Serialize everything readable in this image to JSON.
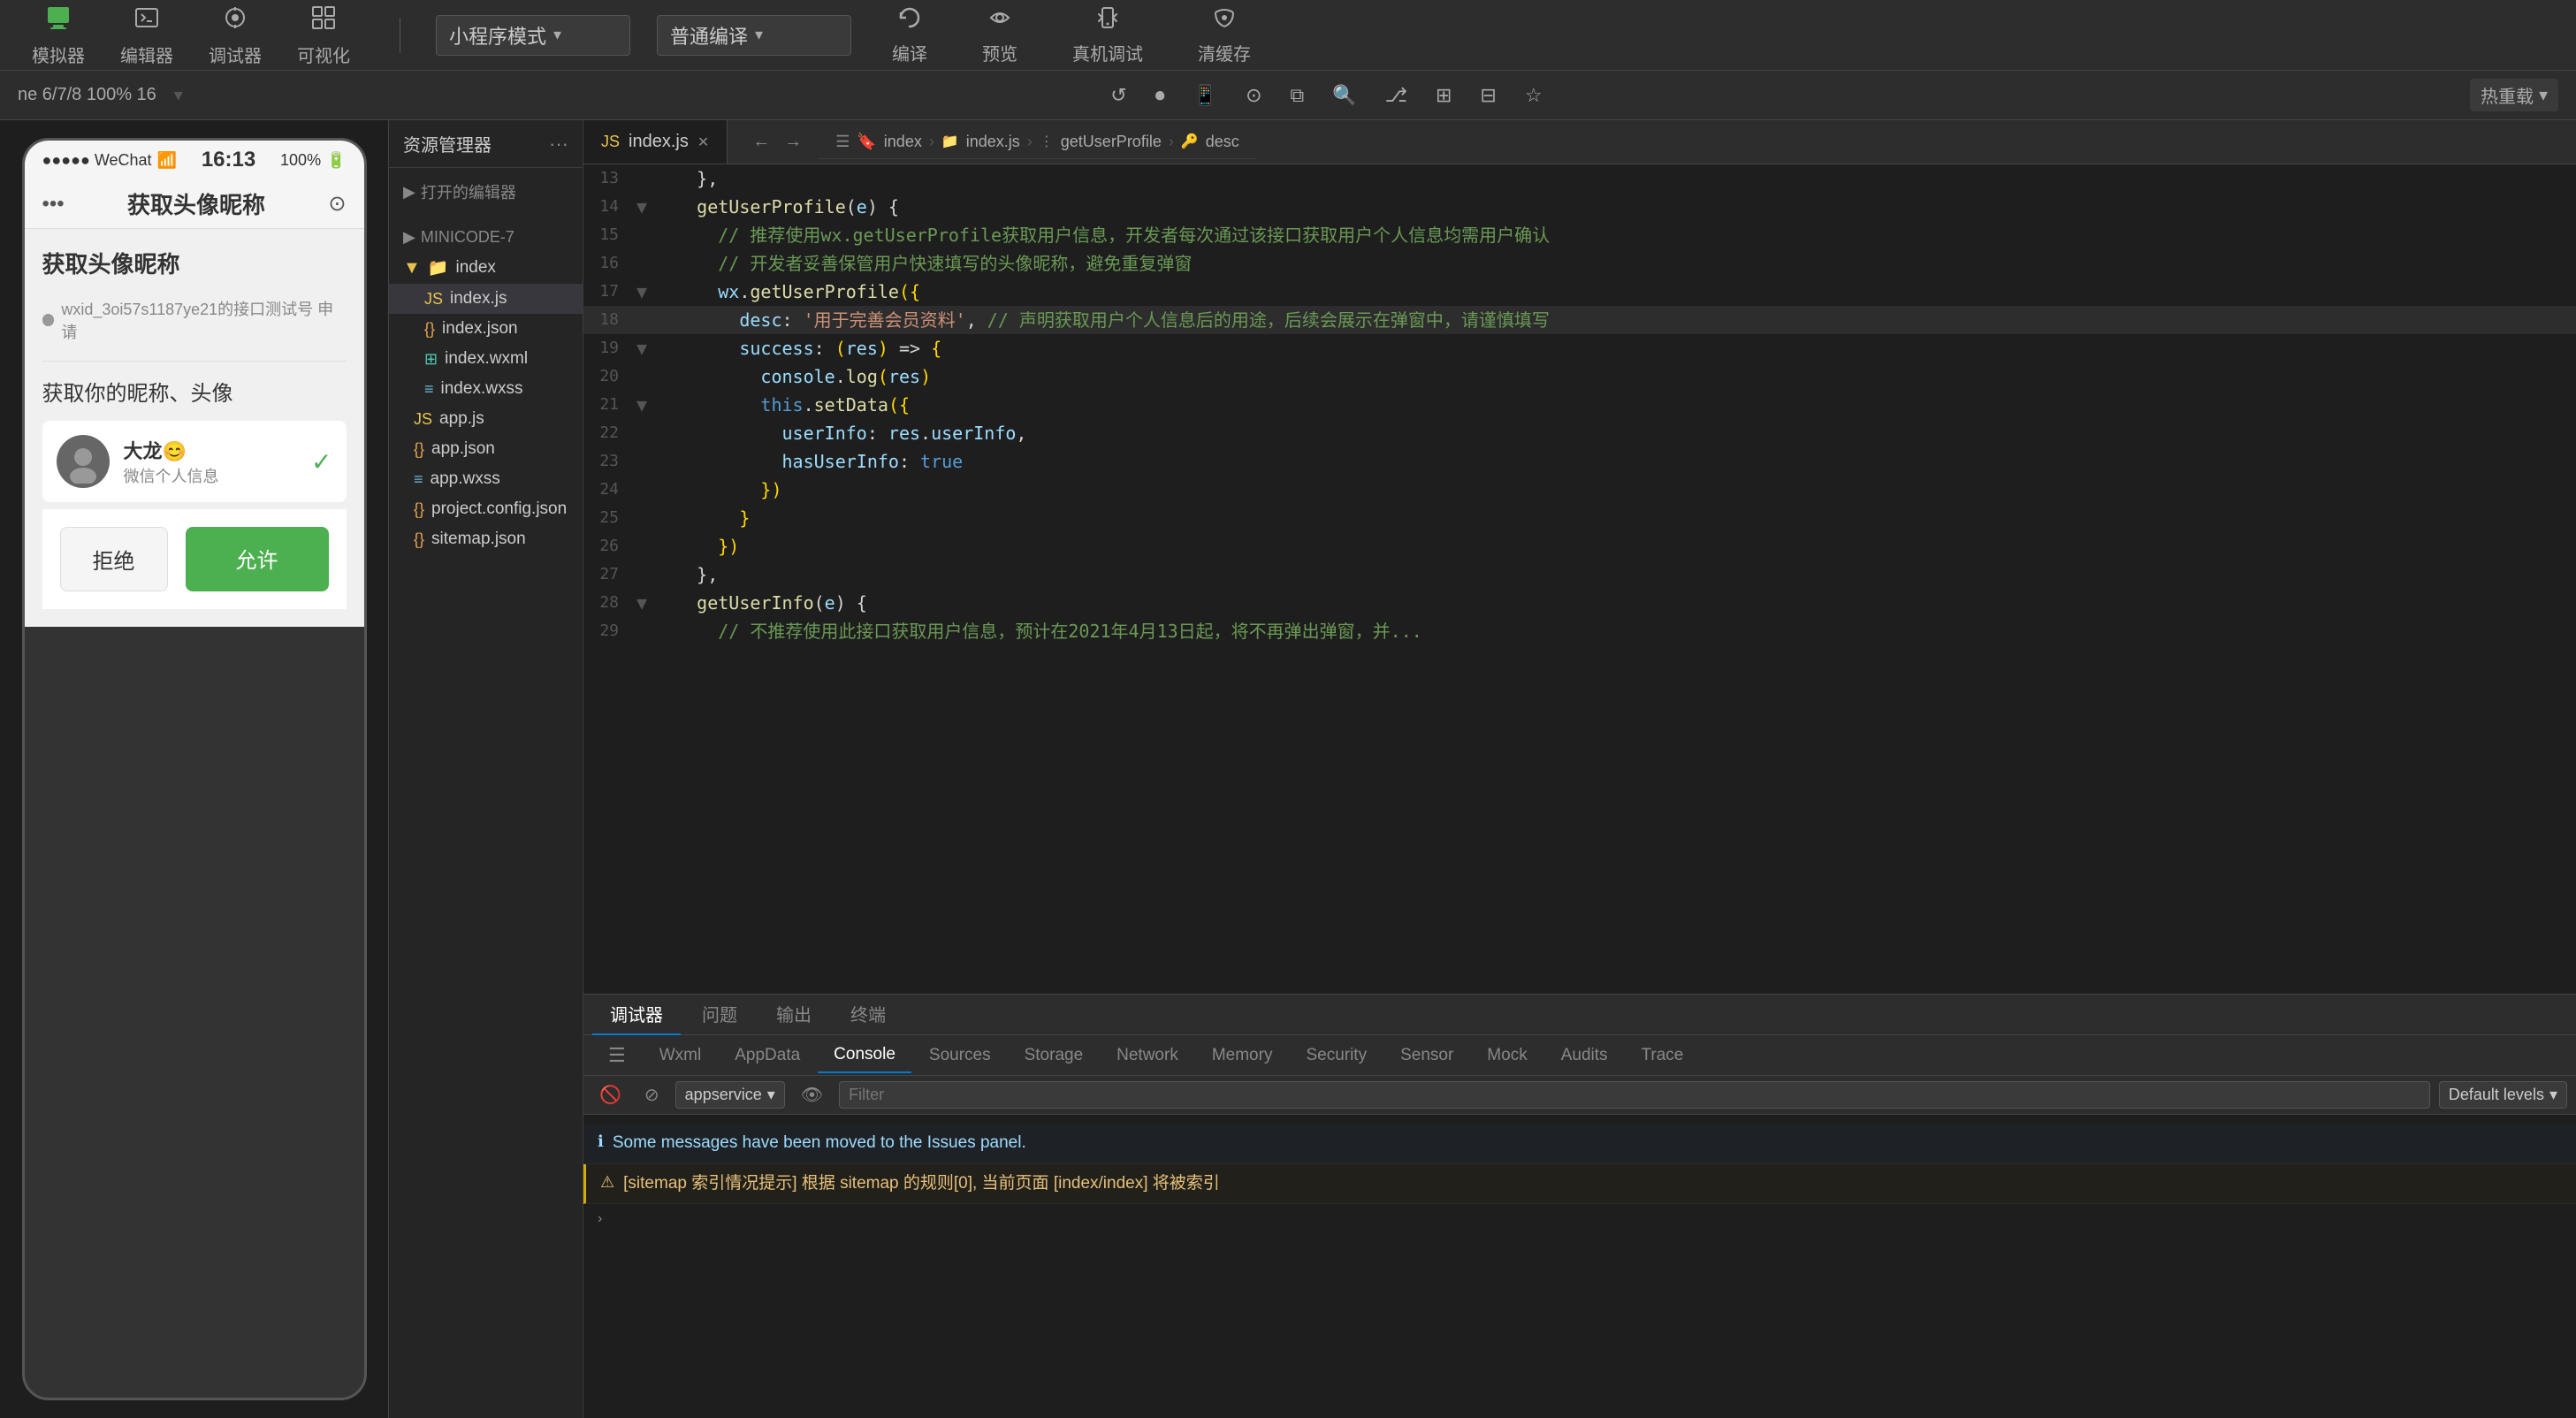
{
  "toolbar": {
    "simulator_label": "模拟器",
    "editor_label": "编辑器",
    "devtools_label": "调试器",
    "visualize_label": "可视化",
    "mode_label": "小程序模式",
    "compile_label": "普通编译",
    "refresh_label": "编译",
    "preview_label": "预览",
    "realtest_label": "真机调试",
    "clearcache_label": "清缓存"
  },
  "secondary_toolbar": {
    "info": "ne 6/7/8 100% 16",
    "hot_reload": "热重载",
    "hot_reload_arrow": "▾"
  },
  "file_panel": {
    "title": "资源管理器",
    "opened_editors": "打开的编辑器",
    "project": "MINICODE-7",
    "folders": [
      {
        "name": "index",
        "files": [
          {
            "name": "index.js",
            "type": "js",
            "active": true
          },
          {
            "name": "index.json",
            "type": "json"
          },
          {
            "name": "index.wxml",
            "type": "wxml"
          },
          {
            "name": "index.wxss",
            "type": "wxss"
          }
        ]
      }
    ],
    "root_files": [
      {
        "name": "app.js",
        "type": "js"
      },
      {
        "name": "app.json",
        "type": "json"
      },
      {
        "name": "app.wxss",
        "type": "wxss"
      },
      {
        "name": "project.config.json",
        "type": "json"
      },
      {
        "name": "sitemap.json",
        "type": "json"
      }
    ]
  },
  "editor": {
    "tab_name": "index.js",
    "breadcrumb": [
      "index",
      "index.js",
      "getUserProfile",
      "desc"
    ],
    "lines": [
      {
        "num": 13,
        "content": "    },"
      },
      {
        "num": 14,
        "content": "    getUserProfile(e) {",
        "fold": true
      },
      {
        "num": 15,
        "content": "      // 推荐使用wx.getUserProfile获取用户信息，开发者每次通过该接口获取用户个人信息均需用户确认"
      },
      {
        "num": 16,
        "content": "      // 开发者妥善保管用户快速填写的头像昵称，避免重复弹窗"
      },
      {
        "num": 17,
        "content": "      wx.getUserProfile({",
        "fold": true
      },
      {
        "num": 18,
        "content": "        desc: '用于完善会员资料', // 声明获取用户个人信息后的用途，后续会展示在弹窗中，请谨慎填写"
      },
      {
        "num": 19,
        "content": "        success: (res) => {",
        "fold": true
      },
      {
        "num": 20,
        "content": "          console.log(res)"
      },
      {
        "num": 21,
        "content": "          this.setData({",
        "fold": true
      },
      {
        "num": 22,
        "content": "            userInfo: res.userInfo,"
      },
      {
        "num": 23,
        "content": "            hasUserInfo: true"
      },
      {
        "num": 24,
        "content": "          })"
      },
      {
        "num": 25,
        "content": "        }"
      },
      {
        "num": 26,
        "content": "      })"
      },
      {
        "num": 27,
        "content": "    },"
      },
      {
        "num": 28,
        "content": "    getUserInfo(e) {",
        "fold": true
      },
      {
        "num": 29,
        "content": "      // 不推荐使用此接口获取用户信息，预计在2021年4月13日起，将不再弹出弹窗，并..."
      }
    ]
  },
  "debug": {
    "tabs": [
      "调试器",
      "问题",
      "输出",
      "终端"
    ],
    "devtools_tabs": [
      "(icon)",
      "Wxml",
      "AppData",
      "Console",
      "Sources",
      "Storage",
      "Network",
      "Memory",
      "Security",
      "Sensor",
      "Mock",
      "Audits",
      "Trace"
    ],
    "active_devtools_tab": "Console",
    "console": {
      "service": "appservice",
      "filter_placeholder": "Filter",
      "level": "Default levels",
      "messages": [
        {
          "type": "info",
          "text": "Some messages have been moved to the Issues panel."
        },
        {
          "type": "warning",
          "text": "⚠ [sitemap 索引情况提示] 根据 sitemap 的规则[0], 当前页面 [index/index] 将被索引"
        }
      ]
    }
  },
  "phone": {
    "carrier": "●●●●● WeChat",
    "wifi": "奇",
    "time": "16:13",
    "battery": "100%",
    "title": "获取头像昵称",
    "nav_dots": "•••",
    "section1_title": "获取头像昵称",
    "api_info": "wxid_3oi57s1187ye21的接口测试号 申请",
    "section2_title": "获取你的昵称、头像",
    "user": {
      "name": "大龙😊",
      "subtitle": "微信个人信息",
      "avatar": "👤"
    },
    "btn_reject": "拒绝",
    "btn_allow": "允许"
  }
}
